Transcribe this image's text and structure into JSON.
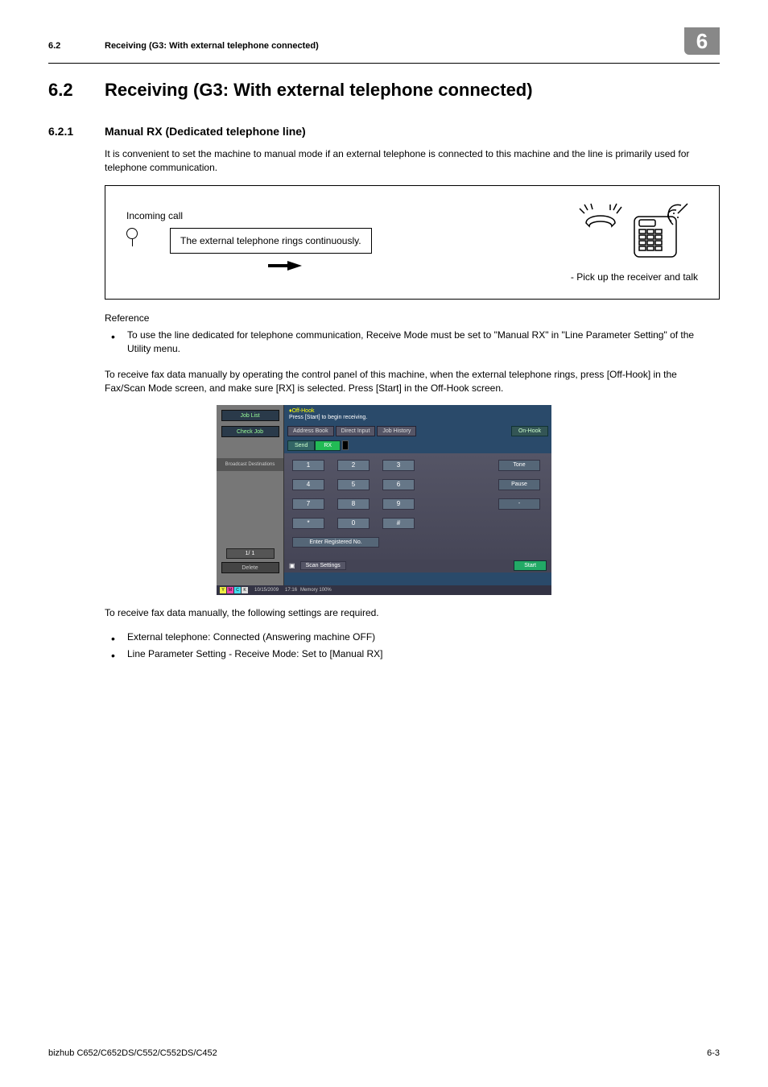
{
  "header": {
    "section_num": "6.2",
    "section_title": "Receiving (G3: With external telephone connected)",
    "chapter_num": "6"
  },
  "section": {
    "num": "6.2",
    "title": "Receiving (G3: With external telephone connected)"
  },
  "subsection": {
    "num": "6.2.1",
    "title": "Manual RX (Dedicated telephone line)"
  },
  "paragraphs": {
    "intro": "It is convenient to set the machine to manual mode if an external telephone is connected to this machine and the line is primarily used for telephone communication.",
    "reference_label": "Reference",
    "reference_bullet": "To use the line dedicated for telephone communication, Receive Mode must be set to \"Manual RX\" in \"Line Parameter Setting\" of the Utility menu.",
    "instruction": "To receive fax data manually by operating the control panel of this machine, when the external telephone rings, press [Off-Hook] in the Fax/Scan Mode screen, and make sure [RX] is selected. Press [Start] in the Off-Hook screen.",
    "settings_intro": "To receive fax data manually, the following settings are required.",
    "settings_bullets": [
      "External telephone: Connected (Answering machine OFF)",
      "Line Parameter Setting - Receive Mode: Set to [Manual RX]"
    ]
  },
  "diagram": {
    "incoming_label": "Incoming call",
    "ring_text": "The external telephone rings continuously.",
    "pickup_text": "- Pick up the receiver and talk"
  },
  "screenshot": {
    "left": {
      "job_list": "Job List",
      "check_job": "Check Job",
      "broadcast": "Broadcast\nDestinations",
      "page": "1/   1",
      "delete": "Delete"
    },
    "top": {
      "offhook_label": "Off-Hook",
      "prompt": "Press [Start] to begin receiving.",
      "tabs": [
        "Address Book",
        "Direct Input",
        "Job History"
      ],
      "onhook": "On-Hook",
      "send": "Send",
      "rx": "RX"
    },
    "keypad": [
      "1",
      "2",
      "3",
      "4",
      "5",
      "6",
      "7",
      "8",
      "9",
      "*",
      "0",
      "#"
    ],
    "side": [
      "Tone",
      "Pause",
      "-"
    ],
    "enter_reg": "Enter Registered No.",
    "scan_settings": "Scan Settings",
    "start": "Start",
    "status": {
      "date": "10/15/2009",
      "time": "17:16",
      "memory_label": "Memory",
      "memory_value": "100%"
    }
  },
  "footer": {
    "model": "bizhub C652/C652DS/C552/C552DS/C452",
    "page": "6-3"
  }
}
